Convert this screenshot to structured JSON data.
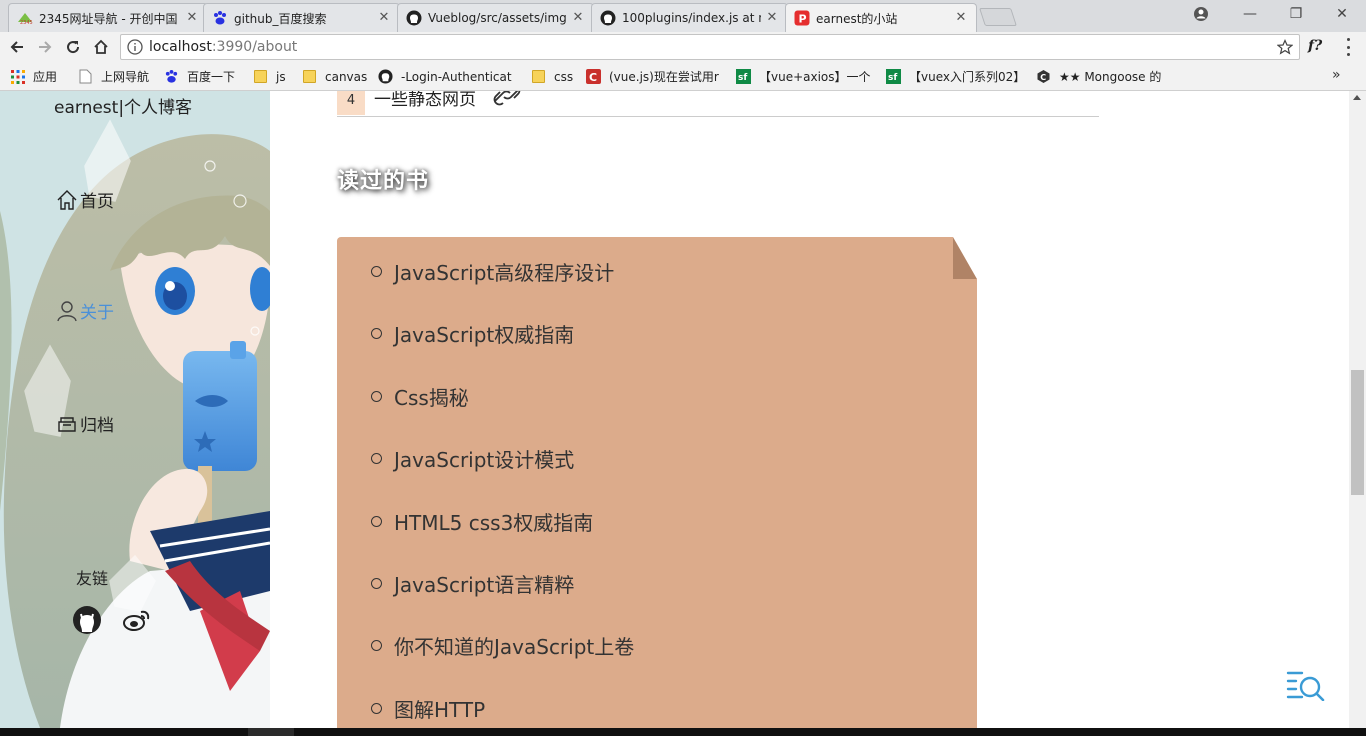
{
  "browser": {
    "tabs": [
      {
        "title": "2345网址导航 - 开创中国",
        "icon": "2345-icon",
        "active": false
      },
      {
        "title": "github_百度搜索",
        "icon": "baidu-paw-icon",
        "active": false
      },
      {
        "title": "Vueblog/src/assets/img",
        "icon": "github-icon",
        "active": false
      },
      {
        "title": "100plugins/index.js at n",
        "icon": "github-icon",
        "active": false
      },
      {
        "title": "earnest的小站",
        "icon": "p-logo-icon",
        "active": true
      }
    ],
    "url_host": "localhost",
    "url_path": ":3990/about",
    "extension_label": "f?",
    "bookmarks": [
      {
        "label": "应用",
        "icon": "apps-grid-icon"
      },
      {
        "label": "上网导航",
        "icon": "page-icon"
      },
      {
        "label": "百度一下",
        "icon": "baidu-paw-icon"
      },
      {
        "label": "js",
        "icon": "folder-icon"
      },
      {
        "label": "canvas",
        "icon": "folder-icon"
      },
      {
        "label": "-Login-Authenticat",
        "icon": "github-icon"
      },
      {
        "label": "css",
        "icon": "folder-icon"
      },
      {
        "label": "(vue.js)现在尝试用r",
        "icon": "c-logo-icon"
      },
      {
        "label": "【vue+axios】一个",
        "icon": "sf-icon"
      },
      {
        "label": "【vuex入门系列02】",
        "icon": "sf-icon"
      },
      {
        "label": "★★ Mongoose 的",
        "icon": "c-dark-icon"
      }
    ],
    "bookmarks_more": "»"
  },
  "sidebar": {
    "site_title": "earnest|个人博客",
    "nav": [
      {
        "label": "首页",
        "icon": "home-icon",
        "active": false
      },
      {
        "label": "关于",
        "icon": "user-icon",
        "active": true
      },
      {
        "label": "归档",
        "icon": "archive-icon",
        "active": false
      }
    ],
    "friends_label": "友链",
    "social": [
      {
        "name": "github",
        "icon": "github-icon"
      },
      {
        "name": "weibo",
        "icon": "weibo-icon"
      }
    ]
  },
  "main": {
    "project": {
      "number": "4",
      "text": "一些静态网页",
      "icon": "link-icon"
    },
    "books_title": "读过的书",
    "books": [
      "JavaScript高级程序设计",
      "JavaScript权威指南",
      "Css揭秘",
      "JavaScript设计模式",
      "HTML5 css3权威指南",
      "JavaScript语言精粹",
      "你不知道的JavaScript上卷",
      "图解HTTP"
    ],
    "search_icon": "search-list-icon"
  },
  "colors": {
    "book_panel": "#dcab8b",
    "project_badge": "#f9dcc6",
    "active_link": "#4a90d9",
    "fab": "#3a9bd5"
  }
}
